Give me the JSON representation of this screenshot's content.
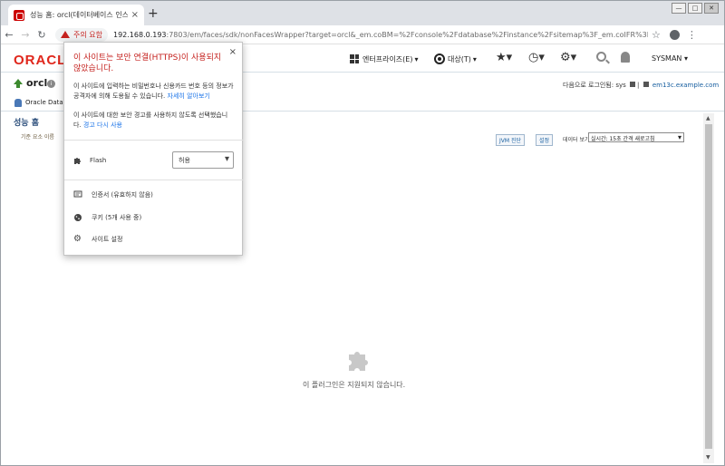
{
  "browser": {
    "tab_title": "성능 홈: orcl(데이터베이스 인스",
    "tab_close": "×",
    "new_tab": "+",
    "window_controls": [
      "—",
      "□",
      "✕"
    ],
    "security_chip_label": "주의 요함",
    "url_host": "192.168.0.193",
    "url_rest": ":7803/em/faces/sdk/nonFacesWrapper?target=orcl&_em.coBM=%2Fconsole%2Fdatabase%2Finstance%2Fsitemap%3F_em.coIFR%3Dtru..."
  },
  "em_header": {
    "logo_text": "ORACLE",
    "enterprise_menu": "엔터프라이즈(E)",
    "target_menu": "대상(T)",
    "user_menu": "SYSMAN"
  },
  "target": {
    "name": "orcl",
    "info_icon": "i",
    "login_label": "다음으로 로그인됨: sys",
    "host_link": "em13c.example.com",
    "subnav_label": "Oracle Datab"
  },
  "page": {
    "title": "성능 홈",
    "subtitle": "기준 요소 이름",
    "jvm_button": "JVM 진단",
    "settings_button": "설정",
    "data_view_label": "데이터 보기",
    "data_view_value": "실시간: 15초 간격 새로고침",
    "plugin_message": "이 플러그인은 지원되지 않습니다."
  },
  "popup": {
    "heading": "이 사이트는 보안 연결(HTTPS)이 사용되지 않았습니다.",
    "paragraph1": "이 사이트에 입력하는 비밀번호나 신용카드 번호 등의 정보가 공격자에 의해 도용될 수 있습니다.",
    "learn_more": "자세히 알아보기",
    "paragraph2": "이 사이트에 대한 보안 경고를 사용하지 않도록 선택했습니다.",
    "reenable_warnings": "경고 다시 사용",
    "flash_label": "Flash",
    "flash_value": "허용",
    "certificate_label": "인증서 (유효하지 않음)",
    "cookies_label": "쿠키 (5개 사용 중)",
    "site_settings_label": "사이트 설정",
    "close": "×"
  },
  "colors": {
    "warning_red": "#c5221f",
    "oracle_red": "#e0261b",
    "link_blue": "#1a73e8"
  }
}
